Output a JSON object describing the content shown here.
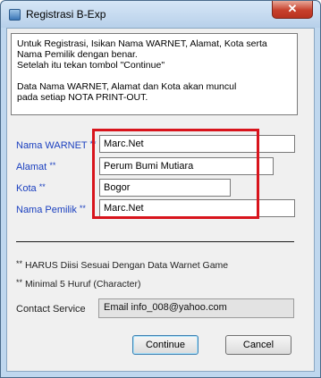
{
  "window": {
    "title": "Registrasi B-Exp",
    "close_glyph": "✕"
  },
  "info": {
    "lines": [
      "Untuk Registrasi, Isikan Nama WARNET, Alamat, Kota serta",
      "Nama Pemilik dengan benar.",
      "Setelah itu tekan tombol \"Continue\"",
      "",
      "Data Nama WARNET, Alamat dan Kota akan muncul",
      "pada setiap NOTA PRINT-OUT."
    ]
  },
  "form": {
    "warnet_label": "Nama WARNET",
    "warnet_value": "Marc.Net",
    "alamat_label": "Alamat",
    "alamat_value": "Perum Bumi Mutiara",
    "kota_label": "Kota",
    "kota_value": "Bogor",
    "pemilik_label": "Nama Pemilik",
    "pemilik_value": "Marc.Net",
    "required_mark": "**"
  },
  "notes": {
    "note1_mark": "**",
    "note1": "HARUS Diisi Sesuai Dengan Data Warnet Game",
    "note2_mark": "**",
    "note2": "Minimal 5 Huruf (Character)"
  },
  "contact": {
    "label": "Contact Service",
    "value": "Email info_008@yahoo.com"
  },
  "buttons": {
    "continue": "Continue",
    "cancel": "Cancel"
  },
  "colors": {
    "label_blue": "#1a3fbf",
    "highlight_red": "#d8141c"
  }
}
